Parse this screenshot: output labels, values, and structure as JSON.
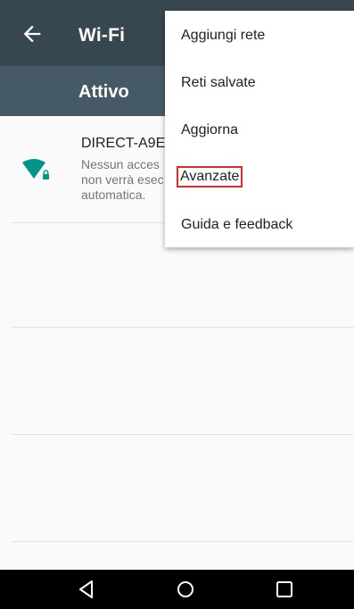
{
  "appbar": {
    "title": "Wi-Fi",
    "switch_label": "Attivo",
    "icon": "arrow-back-icon"
  },
  "network": {
    "name": "DIRECT-A9E",
    "description": "Nessun acces\nnon verrà esec\nautomatica.",
    "icon": "wifi-locked-icon"
  },
  "menu": {
    "items": [
      {
        "label": "Aggiungi rete"
      },
      {
        "label": "Reti salvate"
      },
      {
        "label": "Aggiorna"
      },
      {
        "label": "Avanzate",
        "highlighted": true
      },
      {
        "label": "Guida e feedback"
      }
    ]
  },
  "navbar": {
    "icons": [
      "back-triangle-icon",
      "home-circle-icon",
      "recents-square-icon"
    ]
  },
  "colors": {
    "appbar": "#37474f",
    "switch_bar": "#455a64",
    "wifi_icon": "#009688",
    "highlight": "#d32f2f"
  }
}
